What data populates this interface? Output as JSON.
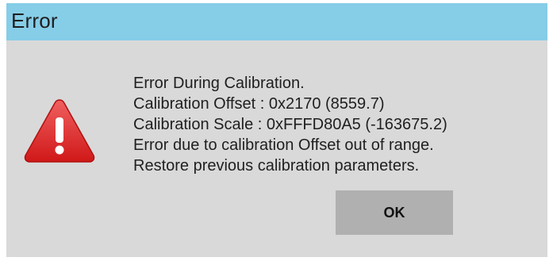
{
  "dialog": {
    "title": "Error",
    "icon": "warning-icon",
    "message_lines": [
      "Error During Calibration.",
      "Calibration Offset : 0x2170 (8559.7)",
      "Calibration Scale : 0xFFFD80A5 (-163675.2)",
      "Error due to calibration Offset out of range.",
      "Restore previous calibration parameters."
    ],
    "ok_label": "OK"
  },
  "colors": {
    "titlebar": "#86cde8",
    "body": "#d9d9d9",
    "button": "#b0b0b0",
    "warning_red": "#e02020"
  }
}
